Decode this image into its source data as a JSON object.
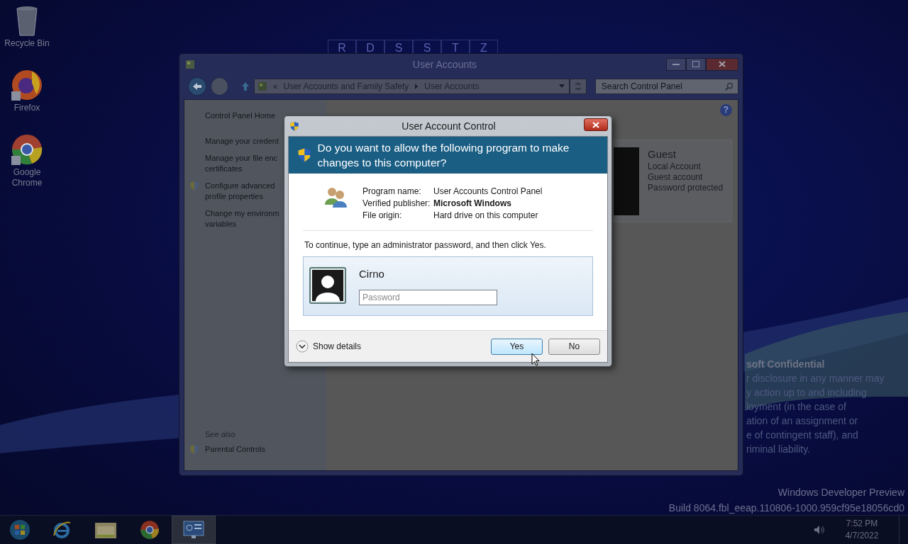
{
  "desktop_icons": [
    {
      "label": "Recycle Bin",
      "kind": "bin"
    },
    {
      "label": "Firefox",
      "kind": "firefox"
    },
    {
      "label": "Google Chrome",
      "kind": "chrome"
    }
  ],
  "background_letters": [
    "R",
    "D",
    "S",
    "S",
    "T",
    "Z"
  ],
  "confidential_notice": {
    "title": "soft Confidential",
    "lines": [
      "r disclosure in any manner may",
      "y action up to and including",
      "loyment (in the case of",
      "ation of an assignment or",
      "e of contingent staff), and",
      "riminal liability."
    ]
  },
  "watermark": {
    "line_1": "Windows Developer Preview",
    "line_2": "Build 8064.fbl_eeap.110806-1000.959cf95e18056cd0"
  },
  "window": {
    "title": "User Accounts",
    "address": {
      "overflow": "«",
      "crumbs": [
        "User Accounts and Family Safety",
        "User Accounts"
      ]
    },
    "search": {
      "placeholder": "Search Control Panel"
    },
    "help_button": "?",
    "sidebar": {
      "items": [
        {
          "lines": [
            "Control Panel Home"
          ],
          "shield": false
        },
        {
          "lines": [
            "Manage your credent"
          ],
          "shield": false
        },
        {
          "lines": [
            "Manage your file enc",
            "certificates"
          ],
          "shield": false
        },
        {
          "lines": [
            "Configure advanced",
            "profile properties"
          ],
          "shield": true
        },
        {
          "lines": [
            "Change my environm",
            "variables"
          ],
          "shield": false
        }
      ],
      "see_also": {
        "heading": "See also",
        "items": [
          {
            "label": "Parental Controls",
            "shield": true
          }
        ]
      }
    },
    "account_card": {
      "name": "Guest",
      "details": [
        "Local Account",
        "Guest account",
        "Password protected"
      ]
    }
  },
  "dialog": {
    "title": "User Account Control",
    "question": "Do you want to allow the following program to make changes to this computer?",
    "program_info": [
      {
        "label": "Program name:",
        "value": "User Accounts Control Panel",
        "bold": false
      },
      {
        "label": "Verified publisher:",
        "value": "Microsoft Windows",
        "bold": true
      },
      {
        "label": "File origin:",
        "value": "Hard drive on this computer",
        "bold": false
      }
    ],
    "instruction": "To continue, type an administrator password, and then click Yes.",
    "account": {
      "name": "Cirno",
      "password_placeholder": "Password"
    },
    "details_toggle": {
      "label": "Show details",
      "expanded": false
    },
    "buttons": [
      {
        "label": "Yes",
        "default": true
      },
      {
        "label": "No",
        "default": false
      }
    ]
  },
  "taskbar": {
    "items": [
      {
        "kind": "start",
        "selected": false
      },
      {
        "kind": "ie",
        "selected": false
      },
      {
        "kind": "explorer",
        "selected": false
      },
      {
        "kind": "chrome",
        "selected": false
      },
      {
        "kind": "control-panel",
        "selected": true
      }
    ],
    "clock": {
      "time": "7:52 PM",
      "date": "4/7/2022"
    }
  }
}
